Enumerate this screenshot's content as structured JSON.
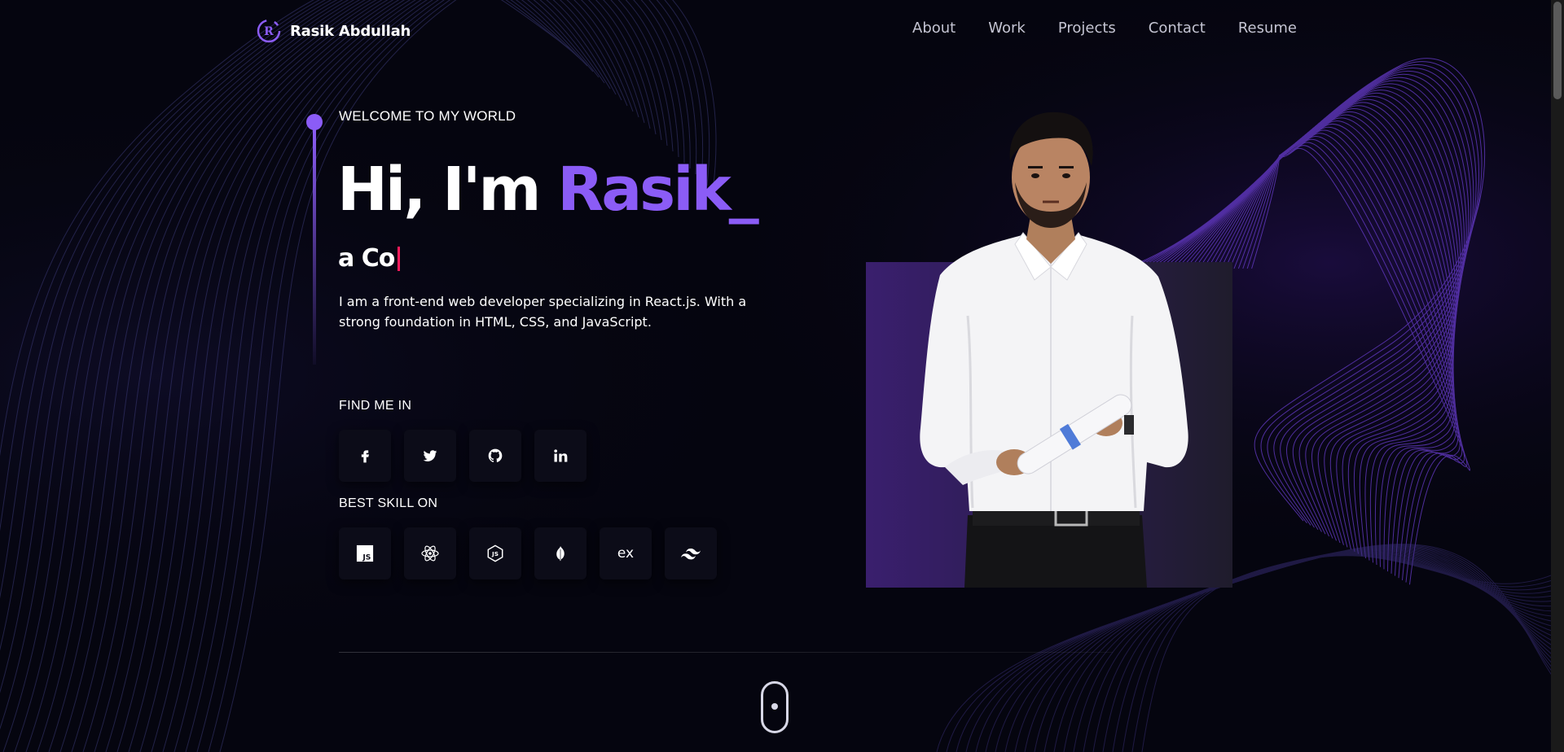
{
  "header": {
    "logo_letter": "R",
    "brand_name": "Rasik Abdullah",
    "nav": [
      {
        "label": "About"
      },
      {
        "label": "Work"
      },
      {
        "label": "Projects"
      },
      {
        "label": "Contact"
      },
      {
        "label": "Resume"
      }
    ]
  },
  "hero": {
    "welcome": "WELCOME TO MY WORLD",
    "greeting": "Hi, I'm",
    "name": "Rasik",
    "cursor": "_",
    "typing_text": "a Co",
    "intro": "I am a front-end web developer specializing in React.js. With a strong foundation in HTML, CSS, and JavaScript.",
    "find_me_label": "FIND ME IN",
    "skills_label": "BEST SKILL ON",
    "social": [
      {
        "icon": "facebook-icon"
      },
      {
        "icon": "twitter-icon"
      },
      {
        "icon": "github-icon"
      },
      {
        "icon": "linkedin-icon"
      }
    ],
    "skills": [
      {
        "icon": "javascript-icon",
        "text": "JS"
      },
      {
        "icon": "react-icon"
      },
      {
        "icon": "nodejs-icon",
        "text": "JS"
      },
      {
        "icon": "mongodb-icon"
      },
      {
        "icon": "express-icon",
        "text": "ex"
      },
      {
        "icon": "tailwind-icon"
      }
    ]
  },
  "colors": {
    "background": "#05050f",
    "accent": "#8b5cf6",
    "caret": "#ff1a5b",
    "nav_text": "#c4c4d2"
  }
}
